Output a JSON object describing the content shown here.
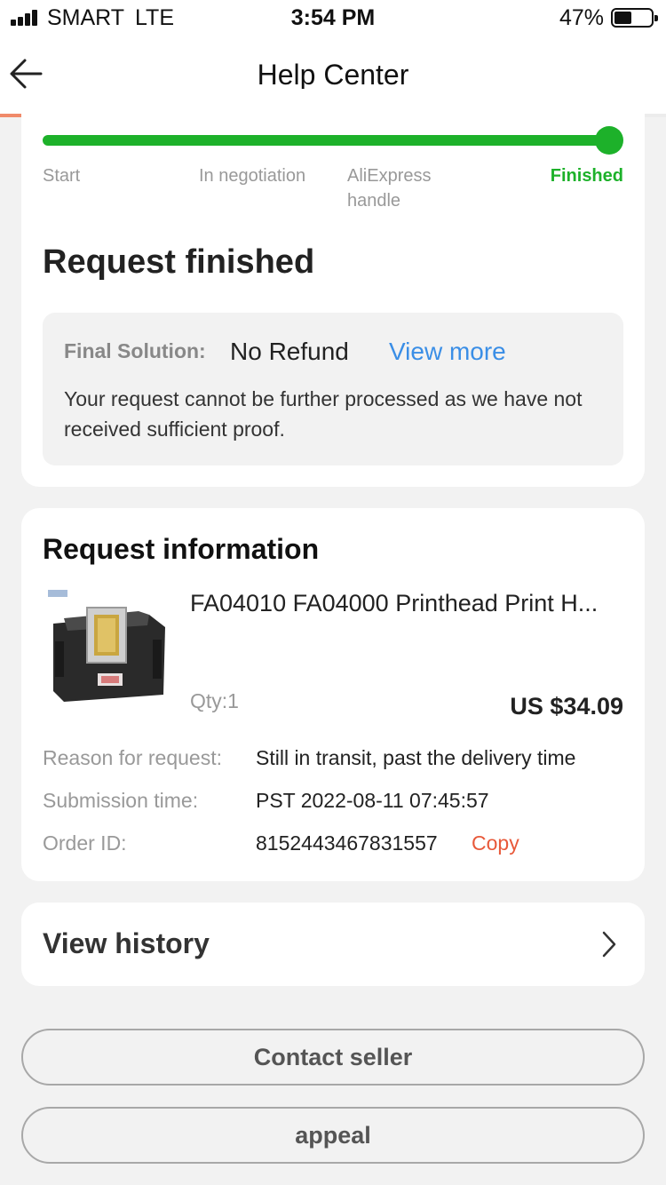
{
  "status_bar": {
    "carrier": "SMART",
    "network": "LTE",
    "time": "3:54 PM",
    "battery_percent": "47%",
    "battery_level": 0.47
  },
  "nav": {
    "title": "Help Center",
    "page_load_progress": 0.5
  },
  "progress": {
    "steps": [
      "Start",
      "In negotiation",
      "AliExpress handle",
      "Finished"
    ],
    "current_step": "Finished",
    "fraction_complete": 1.0,
    "active_color": "#1db12a"
  },
  "request_status": {
    "title": "Request finished",
    "final_solution_label": "Final Solution:",
    "final_solution_value": "No Refund",
    "view_more_label": "View more",
    "description": "Your request cannot be further processed as we have not received sufficient proof."
  },
  "request_info": {
    "title": "Request information",
    "product": {
      "title": "FA04010 FA04000 Printhead Print H...",
      "qty": "Qty:1",
      "price": "US $34.09",
      "image_icon": "printhead-image"
    },
    "rows": [
      {
        "label": "Reason for request:",
        "value": "Still in transit, past the delivery time"
      },
      {
        "label": "Submission time:",
        "value": "PST 2022-08-11 07:45:57"
      },
      {
        "label": "Order ID:",
        "value": "8152443467831557"
      }
    ],
    "copy_label": "Copy"
  },
  "history": {
    "label": "View history"
  },
  "actions": {
    "contact_seller": "Contact seller",
    "appeal": "appeal"
  },
  "colors": {
    "accent_green": "#1db12a",
    "link_blue": "#3a8ee6",
    "copy_red": "#e8593a",
    "loading_bar": "#f08a6a"
  }
}
